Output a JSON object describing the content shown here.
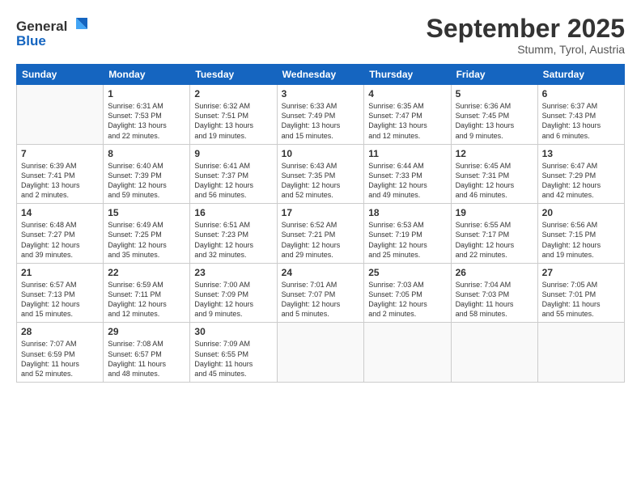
{
  "logo": {
    "line1": "General",
    "line2": "Blue"
  },
  "header": {
    "title": "September 2025",
    "subtitle": "Stumm, Tyrol, Austria"
  },
  "weekdays": [
    "Sunday",
    "Monday",
    "Tuesday",
    "Wednesday",
    "Thursday",
    "Friday",
    "Saturday"
  ],
  "weeks": [
    [
      {
        "day": "",
        "info": ""
      },
      {
        "day": "1",
        "info": "Sunrise: 6:31 AM\nSunset: 7:53 PM\nDaylight: 13 hours\nand 22 minutes."
      },
      {
        "day": "2",
        "info": "Sunrise: 6:32 AM\nSunset: 7:51 PM\nDaylight: 13 hours\nand 19 minutes."
      },
      {
        "day": "3",
        "info": "Sunrise: 6:33 AM\nSunset: 7:49 PM\nDaylight: 13 hours\nand 15 minutes."
      },
      {
        "day": "4",
        "info": "Sunrise: 6:35 AM\nSunset: 7:47 PM\nDaylight: 13 hours\nand 12 minutes."
      },
      {
        "day": "5",
        "info": "Sunrise: 6:36 AM\nSunset: 7:45 PM\nDaylight: 13 hours\nand 9 minutes."
      },
      {
        "day": "6",
        "info": "Sunrise: 6:37 AM\nSunset: 7:43 PM\nDaylight: 13 hours\nand 6 minutes."
      }
    ],
    [
      {
        "day": "7",
        "info": "Sunrise: 6:39 AM\nSunset: 7:41 PM\nDaylight: 13 hours\nand 2 minutes."
      },
      {
        "day": "8",
        "info": "Sunrise: 6:40 AM\nSunset: 7:39 PM\nDaylight: 12 hours\nand 59 minutes."
      },
      {
        "day": "9",
        "info": "Sunrise: 6:41 AM\nSunset: 7:37 PM\nDaylight: 12 hours\nand 56 minutes."
      },
      {
        "day": "10",
        "info": "Sunrise: 6:43 AM\nSunset: 7:35 PM\nDaylight: 12 hours\nand 52 minutes."
      },
      {
        "day": "11",
        "info": "Sunrise: 6:44 AM\nSunset: 7:33 PM\nDaylight: 12 hours\nand 49 minutes."
      },
      {
        "day": "12",
        "info": "Sunrise: 6:45 AM\nSunset: 7:31 PM\nDaylight: 12 hours\nand 46 minutes."
      },
      {
        "day": "13",
        "info": "Sunrise: 6:47 AM\nSunset: 7:29 PM\nDaylight: 12 hours\nand 42 minutes."
      }
    ],
    [
      {
        "day": "14",
        "info": "Sunrise: 6:48 AM\nSunset: 7:27 PM\nDaylight: 12 hours\nand 39 minutes."
      },
      {
        "day": "15",
        "info": "Sunrise: 6:49 AM\nSunset: 7:25 PM\nDaylight: 12 hours\nand 35 minutes."
      },
      {
        "day": "16",
        "info": "Sunrise: 6:51 AM\nSunset: 7:23 PM\nDaylight: 12 hours\nand 32 minutes."
      },
      {
        "day": "17",
        "info": "Sunrise: 6:52 AM\nSunset: 7:21 PM\nDaylight: 12 hours\nand 29 minutes."
      },
      {
        "day": "18",
        "info": "Sunrise: 6:53 AM\nSunset: 7:19 PM\nDaylight: 12 hours\nand 25 minutes."
      },
      {
        "day": "19",
        "info": "Sunrise: 6:55 AM\nSunset: 7:17 PM\nDaylight: 12 hours\nand 22 minutes."
      },
      {
        "day": "20",
        "info": "Sunrise: 6:56 AM\nSunset: 7:15 PM\nDaylight: 12 hours\nand 19 minutes."
      }
    ],
    [
      {
        "day": "21",
        "info": "Sunrise: 6:57 AM\nSunset: 7:13 PM\nDaylight: 12 hours\nand 15 minutes."
      },
      {
        "day": "22",
        "info": "Sunrise: 6:59 AM\nSunset: 7:11 PM\nDaylight: 12 hours\nand 12 minutes."
      },
      {
        "day": "23",
        "info": "Sunrise: 7:00 AM\nSunset: 7:09 PM\nDaylight: 12 hours\nand 9 minutes."
      },
      {
        "day": "24",
        "info": "Sunrise: 7:01 AM\nSunset: 7:07 PM\nDaylight: 12 hours\nand 5 minutes."
      },
      {
        "day": "25",
        "info": "Sunrise: 7:03 AM\nSunset: 7:05 PM\nDaylight: 12 hours\nand 2 minutes."
      },
      {
        "day": "26",
        "info": "Sunrise: 7:04 AM\nSunset: 7:03 PM\nDaylight: 11 hours\nand 58 minutes."
      },
      {
        "day": "27",
        "info": "Sunrise: 7:05 AM\nSunset: 7:01 PM\nDaylight: 11 hours\nand 55 minutes."
      }
    ],
    [
      {
        "day": "28",
        "info": "Sunrise: 7:07 AM\nSunset: 6:59 PM\nDaylight: 11 hours\nand 52 minutes."
      },
      {
        "day": "29",
        "info": "Sunrise: 7:08 AM\nSunset: 6:57 PM\nDaylight: 11 hours\nand 48 minutes."
      },
      {
        "day": "30",
        "info": "Sunrise: 7:09 AM\nSunset: 6:55 PM\nDaylight: 11 hours\nand 45 minutes."
      },
      {
        "day": "",
        "info": ""
      },
      {
        "day": "",
        "info": ""
      },
      {
        "day": "",
        "info": ""
      },
      {
        "day": "",
        "info": ""
      }
    ]
  ]
}
